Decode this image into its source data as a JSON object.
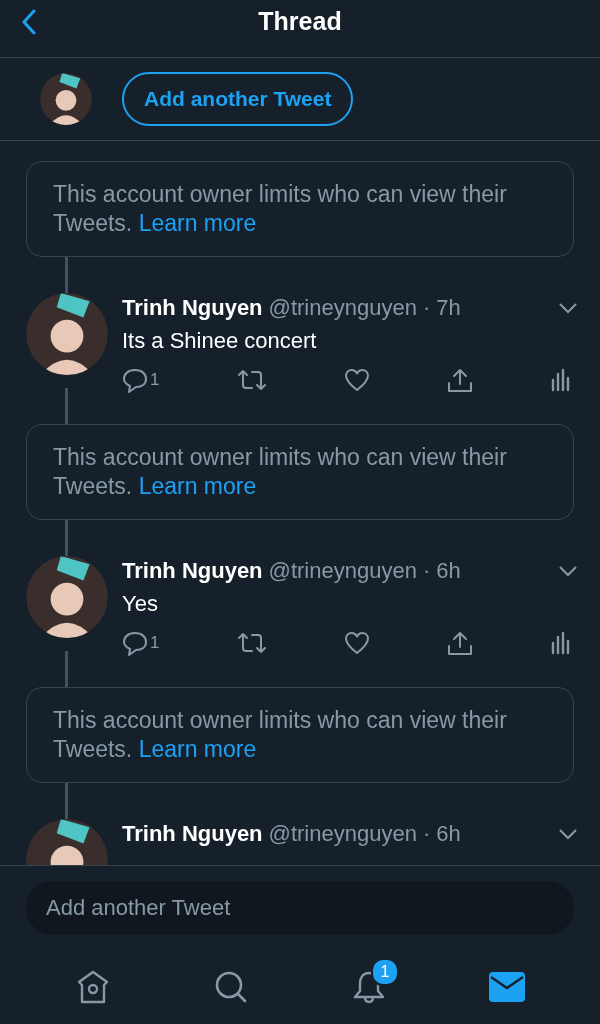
{
  "header": {
    "title": "Thread"
  },
  "compose_prompt": {
    "label": "Add another Tweet"
  },
  "thread": [
    {
      "kind": "notice",
      "text": "This account owner limits who can view their Tweets.",
      "link": "Learn more"
    },
    {
      "kind": "tweet",
      "name": "Trinh Nguyen",
      "handle": "@trineynguyen",
      "time": "· 7h",
      "text": "Its a Shinee concert",
      "reply_count": "1"
    },
    {
      "kind": "notice",
      "text": "This account owner limits who can view their Tweets.",
      "link": "Learn more"
    },
    {
      "kind": "tweet",
      "name": "Trinh Nguyen",
      "handle": "@trineynguyen",
      "time": "· 6h",
      "text": "Yes",
      "reply_count": "1"
    },
    {
      "kind": "notice",
      "text": "This account owner limits who can view their Tweets.",
      "link": "Learn more"
    },
    {
      "kind": "tweet",
      "name": "Trinh Nguyen",
      "handle": "@trineynguyen",
      "time": "· 6h"
    }
  ],
  "composer": {
    "placeholder": "Add another Tweet"
  },
  "tab_bar": [
    {
      "kind": "home",
      "selected": false
    },
    {
      "kind": "search",
      "selected": false
    },
    {
      "kind": "notifications",
      "selected": false,
      "badge": "1"
    },
    {
      "kind": "messages",
      "selected": true
    }
  ]
}
